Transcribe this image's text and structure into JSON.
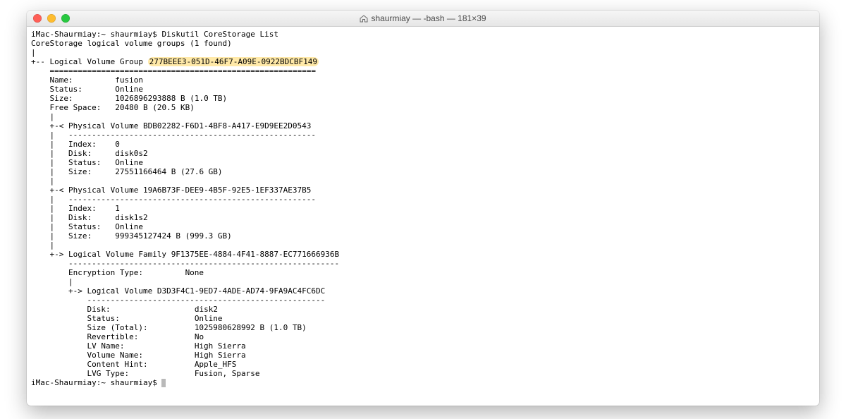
{
  "window": {
    "title": "shaurmiay — -bash — 181×39"
  },
  "prompt": {
    "host": "iMac-Shaurmiay",
    "path": "~",
    "user": "shaurmiay",
    "command": "Diskutil CoreStorage List"
  },
  "header_line": "CoreStorage logical volume groups (1 found)",
  "lvg": {
    "label": "Logical Volume Group",
    "uuid": "277BEEE3-051D-46F7-A09E-0922BDCBF149",
    "sep": "=========================================================",
    "name_label": "Name:",
    "name": "fusion",
    "status_label": "Status:",
    "status": "Online",
    "size_label": "Size:",
    "size": "1026896293888 B (1.0 TB)",
    "free_label": "Free Space:",
    "free": "20480 B (20.5 KB)"
  },
  "pv_sep": "-----------------------------------------------------",
  "pv0": {
    "label": "Physical Volume",
    "uuid": "BDB02282-F6D1-4BF8-A417-E9D9EE2D0543",
    "index_label": "Index:",
    "index": "0",
    "disk_label": "Disk:",
    "disk": "disk0s2",
    "status_label": "Status:",
    "status": "Online",
    "size_label": "Size:",
    "size": "27551166464 B (27.6 GB)"
  },
  "pv1": {
    "label": "Physical Volume",
    "uuid": "19A6B73F-DEE9-4B5F-92E5-1EF337AE37B5",
    "index_label": "Index:",
    "index": "1",
    "disk_label": "Disk:",
    "disk": "disk1s2",
    "status_label": "Status:",
    "status": "Online",
    "size_label": "Size:",
    "size": "999345127424 B (999.3 GB)"
  },
  "lvf": {
    "label": "Logical Volume Family",
    "uuid": "9F1375EE-4884-4F41-8887-EC771666936B",
    "sep": "----------------------------------------------------------",
    "enc_label": "Encryption Type:",
    "enc": "None"
  },
  "lv": {
    "label": "Logical Volume",
    "uuid": "D3D3F4C1-9ED7-4ADE-AD74-9FA9AC4FC6DC",
    "sep": "---------------------------------------------------",
    "disk_label": "Disk:",
    "disk": "disk2",
    "status_label": "Status:",
    "status": "Online",
    "sizet_label": "Size (Total):",
    "sizet": "1025980628992 B (1.0 TB)",
    "rev_label": "Revertible:",
    "rev": "No",
    "lvname_label": "LV Name:",
    "lvname": "High Sierra",
    "volname_label": "Volume Name:",
    "volname": "High Sierra",
    "chint_label": "Content Hint:",
    "chint": "Apple_HFS",
    "lvgtype_label": "LVG Type:",
    "lvgtype": "Fusion, Sparse"
  }
}
